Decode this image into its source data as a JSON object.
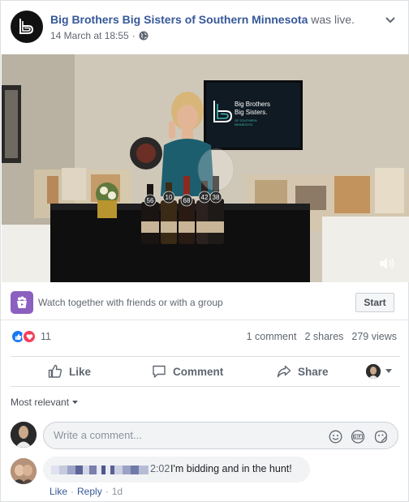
{
  "post": {
    "page_name": "Big Brothers Big Sisters of Southern Minnesota",
    "live_status": "was live.",
    "date": "14 March at 18:55",
    "separator": "·"
  },
  "video": {
    "tv_screen_text": [
      "Big Brothers",
      "Big Sisters.",
      "OF SOUTHERN",
      "MINNESOTA"
    ],
    "bottle_tags": [
      "56",
      "10",
      "68",
      "42",
      "38"
    ]
  },
  "watch": {
    "text": "Watch together with friends or with a group",
    "start_label": "Start"
  },
  "stats": {
    "reaction_count": "11",
    "comments": "1 comment",
    "shares": "2 shares",
    "views": "279 views"
  },
  "actions": {
    "like": "Like",
    "comment": "Comment",
    "share": "Share"
  },
  "comments": {
    "sort_label": "Most relevant",
    "placeholder": "Write a comment...",
    "icons": [
      "emoji-icon",
      "gif-icon",
      "sticker-icon"
    ],
    "items": [
      {
        "timestamp": "2:02",
        "text": "I'm bidding and in the hunt!",
        "like": "Like",
        "reply": "Reply",
        "time": "1d",
        "dot": "·"
      }
    ]
  },
  "colors": {
    "link_blue": "#365899",
    "like_blue": "#1877f2",
    "love_red": "#f33e58",
    "watch_purple": "#8b5fbf"
  }
}
